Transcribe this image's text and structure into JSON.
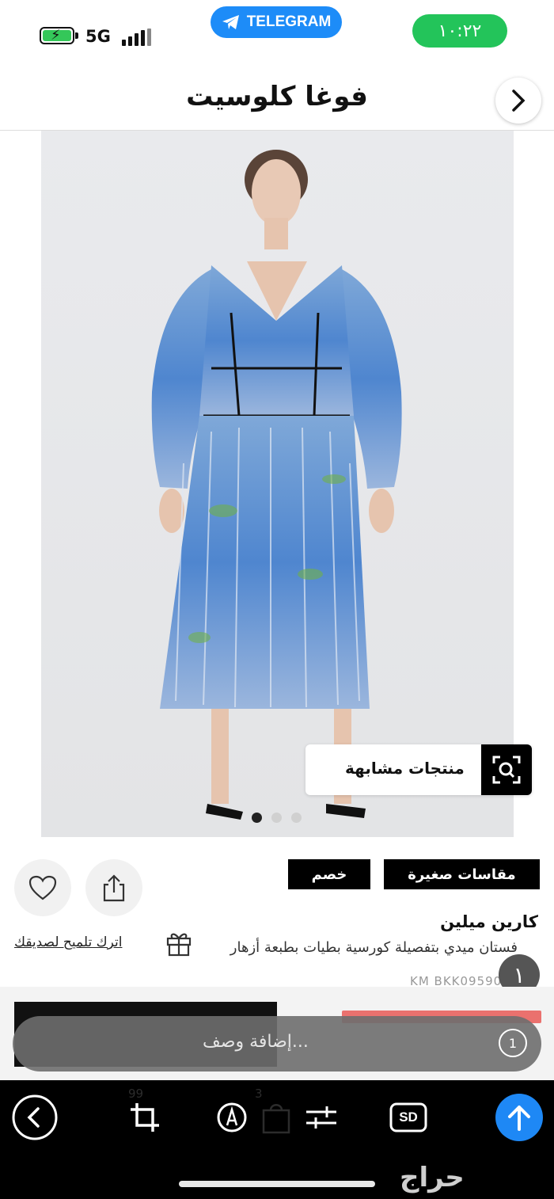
{
  "status_bar": {
    "network": "5G",
    "telegram_label": "TELEGRAM",
    "time": "١٠:٢٢"
  },
  "header": {
    "title": "فوغا كلوسيت"
  },
  "product": {
    "similar_label": "منتجات مشابهة",
    "image_count": 3,
    "active_image": 1,
    "tag_small_sizes": "مقاسات صغيرة",
    "tag_discount": "خصم",
    "brand": "كارين ميلين",
    "description": "فستان ميدي بتفصيلة كورسية بطيات بطبعة أزهار",
    "friend_hint": "اترك تلميح لصديقك",
    "sku": "KM BKK09590-106",
    "badge": "١"
  },
  "reply_bar": {
    "placeholder": "إضافة وصف...",
    "timer": "1"
  },
  "colors": {
    "telegram_blue": "#1d8cf8",
    "time_green": "#23c45a",
    "send_blue": "#1e88f5"
  },
  "toolbar": {
    "sd_label": "SD",
    "faint_left": "99",
    "faint_right": "3"
  },
  "watermark": "حراج"
}
